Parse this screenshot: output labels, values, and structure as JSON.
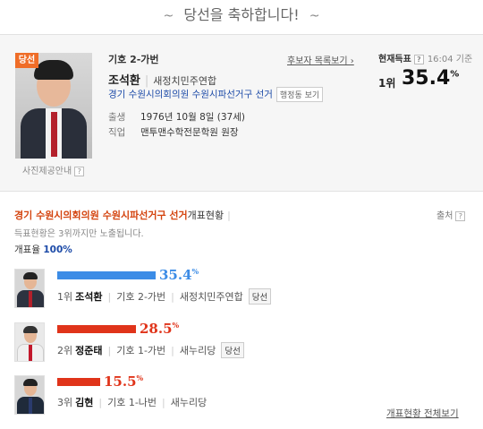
{
  "banner": {
    "title": "당선을 축하합니다!",
    "deco_left": "~",
    "deco_right": "~"
  },
  "profile": {
    "badge": "당선",
    "photo_note": "사진제공안내",
    "ballot": "기호 2-가번",
    "candidate_list_link": "후보자 목록보기 ›",
    "name": "조석환",
    "party": "새정치민주연합",
    "district": "경기 수원시의회의원 수원시파선거구 선거",
    "region_button": "행정동 보기",
    "birth_label": "출생",
    "birth_value": "1976년 10월 8일 (37세)",
    "job_label": "직업",
    "job_value": "맨투맨수학전문학원 원장"
  },
  "current": {
    "label": "현재득표",
    "time": "16:04 기준",
    "rank": "1위",
    "pct": "35.4",
    "pct_unit": "%"
  },
  "results": {
    "title": "경기 수원시의회의원 수원시파선거구 선거",
    "subtitle": "개표현황",
    "source": "출처",
    "note": "득표현황은 3위까지만 노출됩니다.",
    "rate_label": "개표율",
    "rate_value": "100%",
    "colors": {
      "first": "#3c8ce6",
      "other": "#e0341a",
      "accent": "#d4440f"
    },
    "rows": [
      {
        "pct": "35.4",
        "unit": "%",
        "rank": "1위",
        "name": "조석환",
        "ballot": "기호 2-가번",
        "party": "새정치민주연합",
        "elected": "당선"
      },
      {
        "pct": "28.5",
        "unit": "%",
        "rank": "2위",
        "name": "정준태",
        "ballot": "기호 1-가번",
        "party": "새누리당",
        "elected": "당선"
      },
      {
        "pct": "15.5",
        "unit": "%",
        "rank": "3위",
        "name": "김현",
        "ballot": "기호 1-나번",
        "party": "새누리당",
        "elected": ""
      }
    ],
    "all_link": "개표현황 전체보기"
  },
  "icons": {
    "help": "help-icon"
  }
}
